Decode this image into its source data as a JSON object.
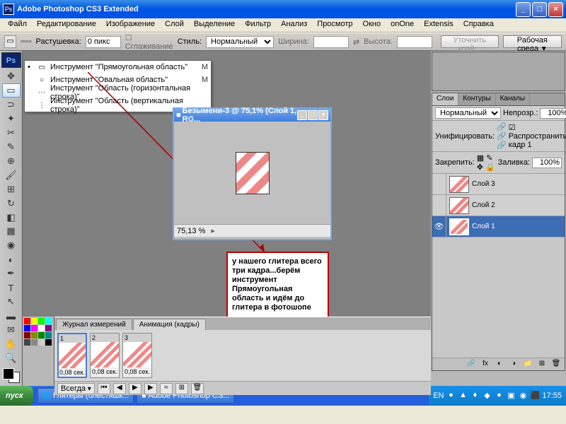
{
  "titlebar": {
    "app": "Adobe Photoshop CS3 Extended"
  },
  "menu": [
    "Файл",
    "Редактирование",
    "Изображение",
    "Слой",
    "Выделение",
    "Фильтр",
    "Анализ",
    "Просмотр",
    "Окно",
    "onOne",
    "Extensis",
    "Справка"
  ],
  "options": {
    "feather_label": "Растушевка:",
    "feather_val": "0 пикс",
    "anti_alias": "Сглаживание",
    "style_label": "Стиль:",
    "style_val": "Нормальный",
    "width_label": "Ширина:",
    "height_label": "Высота:",
    "refine": "Уточнить край...",
    "workspace": "Рабочая среда"
  },
  "context_menu": [
    {
      "label": "Инструмент \"Прямоугольная область\"",
      "key": "M",
      "sel": true,
      "icon": "▭"
    },
    {
      "label": "Инструмент \"Овальная область\"",
      "key": "M",
      "sel": false,
      "icon": "○"
    },
    {
      "label": "Инструмент \"Область (горизонтальная строка)\"",
      "key": "",
      "sel": false,
      "icon": "⋯"
    },
    {
      "label": "Инструмент \"Область (вертикальная строка)\"",
      "key": "",
      "sel": false,
      "icon": "⋮"
    }
  ],
  "doc": {
    "title": "Безымени-3 @ 75,1% (Слой 1, RG...",
    "zoom": "75,13 %"
  },
  "note": "у нашего глитера всего три кадра...берём инструмент Прямоугольная область и идём до глитера в фотошопе",
  "anim": {
    "tab1": "Журнал измерений",
    "tab2": "Анимация (кадры)",
    "frames": [
      "0,08 сек.",
      "0,08 сек.",
      "0,08 сек."
    ],
    "loop": "Всегда"
  },
  "layers": {
    "tab1": "Слои",
    "tab2": "Контуры",
    "tab3": "Каналы",
    "mode": "Нормальный",
    "opacity_lbl": "Непрозр.:",
    "opacity": "100%",
    "unify": "Унифицировать:",
    "spread": "Распространить кадр 1",
    "lock": "Закрепить:",
    "fill_lbl": "Заливка:",
    "fill": "100%",
    "items": [
      {
        "name": "Слой 3"
      },
      {
        "name": "Слой 2"
      },
      {
        "name": "Слой 1",
        "sel": true,
        "vis": true
      }
    ]
  },
  "taskbar": {
    "start": "пуск",
    "tasks": [
      "Глитеры (блестяшк...",
      "Adobe Photoshop CS..."
    ],
    "lang": "EN",
    "time": "17:55"
  }
}
